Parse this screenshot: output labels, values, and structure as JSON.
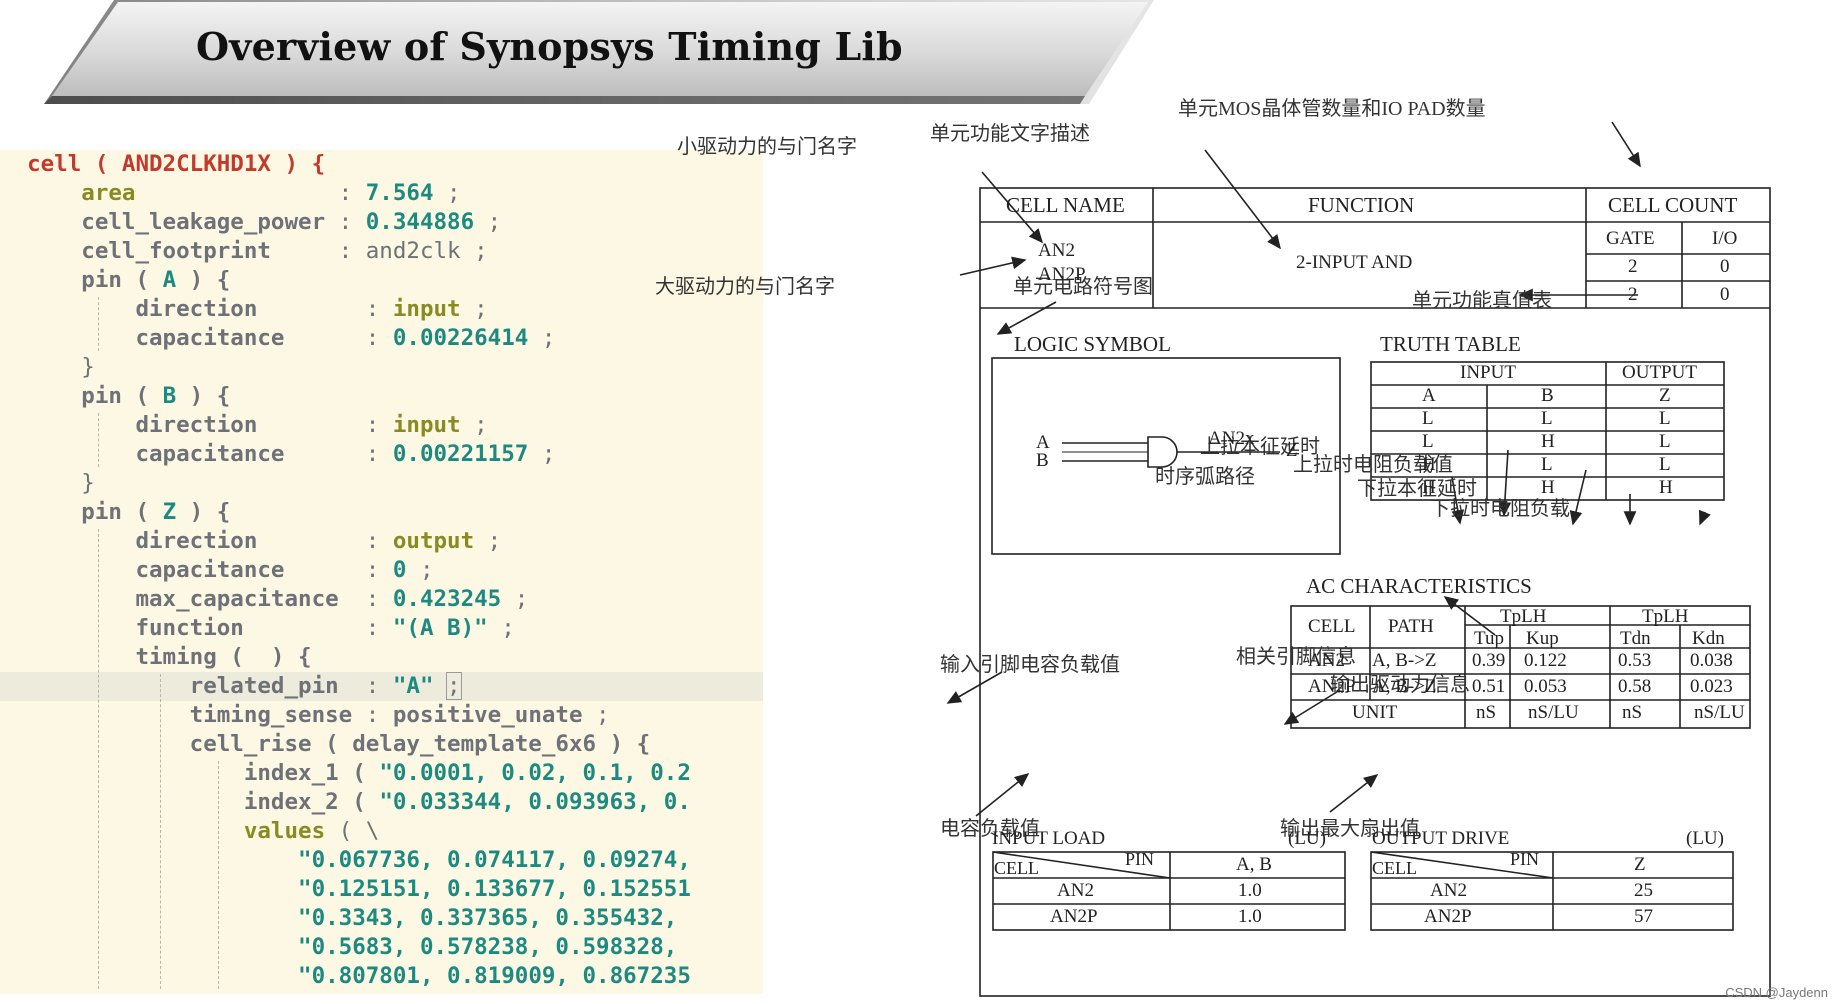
{
  "header": {
    "title": "Overview of Synopsys Timing Lib"
  },
  "code_lines": [
    {
      "tokens": [
        {
          "t": "cell ( AND2CLKHD1X ) {",
          "c": "k-red"
        }
      ]
    },
    {
      "tokens": [
        {
          "t": "    "
        },
        {
          "t": "area",
          "c": "k-ol"
        },
        {
          "t": "               : ",
          "c": "k-gy"
        },
        {
          "t": "7.564",
          "c": "k-val"
        },
        {
          "t": " ;",
          "c": "k-gy"
        }
      ]
    },
    {
      "tokens": [
        {
          "t": "    "
        },
        {
          "t": "cell_leakage_power",
          "c": "k-fn"
        },
        {
          "t": " : ",
          "c": "k-gy"
        },
        {
          "t": "0.344886",
          "c": "k-val"
        },
        {
          "t": " ;",
          "c": "k-gy"
        }
      ]
    },
    {
      "tokens": [
        {
          "t": "    "
        },
        {
          "t": "cell_footprint",
          "c": "k-fn"
        },
        {
          "t": "     : and2clk ;",
          "c": "k-gy"
        }
      ]
    },
    {
      "tokens": [
        {
          "t": "    "
        },
        {
          "t": "pin ( ",
          "c": "k-fn"
        },
        {
          "t": "A",
          "c": "k-val"
        },
        {
          "t": " ) {",
          "c": "k-fn"
        }
      ]
    },
    {
      "tokens": [
        {
          "t": "        "
        },
        {
          "t": "direction",
          "c": "k-fn"
        },
        {
          "t": "        : ",
          "c": "k-gy"
        },
        {
          "t": "input",
          "c": "k-ol"
        },
        {
          "t": " ;",
          "c": "k-gy"
        }
      ]
    },
    {
      "tokens": [
        {
          "t": "        "
        },
        {
          "t": "capacitance",
          "c": "k-fn"
        },
        {
          "t": "      : ",
          "c": "k-gy"
        },
        {
          "t": "0.00226414",
          "c": "k-val"
        },
        {
          "t": " ;",
          "c": "k-gy"
        }
      ]
    },
    {
      "tokens": [
        {
          "t": "    }",
          "c": "k-gy"
        }
      ]
    },
    {
      "tokens": [
        {
          "t": "    "
        },
        {
          "t": "pin ( ",
          "c": "k-fn"
        },
        {
          "t": "B",
          "c": "k-val"
        },
        {
          "t": " ) {",
          "c": "k-fn"
        }
      ]
    },
    {
      "tokens": [
        {
          "t": "        "
        },
        {
          "t": "direction",
          "c": "k-fn"
        },
        {
          "t": "        : ",
          "c": "k-gy"
        },
        {
          "t": "input",
          "c": "k-ol"
        },
        {
          "t": " ;",
          "c": "k-gy"
        }
      ]
    },
    {
      "tokens": [
        {
          "t": "        "
        },
        {
          "t": "capacitance",
          "c": "k-fn"
        },
        {
          "t": "      : ",
          "c": "k-gy"
        },
        {
          "t": "0.00221157",
          "c": "k-val"
        },
        {
          "t": " ;",
          "c": "k-gy"
        }
      ]
    },
    {
      "tokens": [
        {
          "t": "    }",
          "c": "k-gy"
        }
      ]
    },
    {
      "tokens": [
        {
          "t": "    "
        },
        {
          "t": "pin ( ",
          "c": "k-fn"
        },
        {
          "t": "Z",
          "c": "k-val"
        },
        {
          "t": " ) {",
          "c": "k-fn"
        }
      ]
    },
    {
      "tokens": [
        {
          "t": "        "
        },
        {
          "t": "direction",
          "c": "k-fn"
        },
        {
          "t": "        : ",
          "c": "k-gy"
        },
        {
          "t": "output",
          "c": "k-ol"
        },
        {
          "t": " ;",
          "c": "k-gy"
        }
      ]
    },
    {
      "tokens": [
        {
          "t": "        "
        },
        {
          "t": "capacitance",
          "c": "k-fn"
        },
        {
          "t": "      : ",
          "c": "k-gy"
        },
        {
          "t": "0",
          "c": "k-val"
        },
        {
          "t": " ;",
          "c": "k-gy"
        }
      ]
    },
    {
      "tokens": [
        {
          "t": "        "
        },
        {
          "t": "max_capacitance",
          "c": "k-fn"
        },
        {
          "t": "  : ",
          "c": "k-gy"
        },
        {
          "t": "0.423245",
          "c": "k-val"
        },
        {
          "t": " ;",
          "c": "k-gy"
        }
      ]
    },
    {
      "tokens": [
        {
          "t": "        "
        },
        {
          "t": "function",
          "c": "k-fn"
        },
        {
          "t": "         : ",
          "c": "k-gy"
        },
        {
          "t": "\"(A B)\"",
          "c": "k-val"
        },
        {
          "t": " ;",
          "c": "k-gy"
        }
      ]
    },
    {
      "tokens": [
        {
          "t": "        "
        },
        {
          "t": "timing (  ) {",
          "c": "k-fn"
        }
      ]
    },
    {
      "hl": true,
      "tokens": [
        {
          "t": "            "
        },
        {
          "t": "related_pin",
          "c": "k-fn"
        },
        {
          "t": "  : ",
          "c": "k-gy"
        },
        {
          "t": "\"A\"",
          "c": "k-val"
        },
        {
          "t": " "
        },
        {
          "t": ";",
          "c": "k-gy k-cur"
        }
      ]
    },
    {
      "tokens": [
        {
          "t": "            "
        },
        {
          "t": "timing_sense",
          "c": "k-fn"
        },
        {
          "t": " : ",
          "c": "k-gy"
        },
        {
          "t": "positive_unate",
          "c": "k-fn"
        },
        {
          "t": " ;",
          "c": "k-gy"
        }
      ]
    },
    {
      "tokens": [
        {
          "t": "            "
        },
        {
          "t": "cell_rise ( delay_template_6x6 ) {",
          "c": "k-fn"
        }
      ]
    },
    {
      "tokens": [
        {
          "t": "                "
        },
        {
          "t": "index_1 ( ",
          "c": "k-fn"
        },
        {
          "t": "\"0.0001, 0.02, 0.1, 0.2",
          "c": "k-val"
        }
      ]
    },
    {
      "tokens": [
        {
          "t": "                "
        },
        {
          "t": "index_2 ( ",
          "c": "k-fn"
        },
        {
          "t": "\"0.033344, 0.093963, 0.",
          "c": "k-val"
        }
      ]
    },
    {
      "tokens": [
        {
          "t": "                "
        },
        {
          "t": "values",
          "c": "k-ol"
        },
        {
          "t": " ( \\",
          "c": "k-gy"
        }
      ]
    },
    {
      "tokens": [
        {
          "t": "                    "
        },
        {
          "t": "\"0.067736, 0.074117, 0.09274,",
          "c": "k-val"
        }
      ]
    },
    {
      "tokens": [
        {
          "t": "                    "
        },
        {
          "t": "\"0.125151, 0.133677, 0.152551",
          "c": "k-val"
        }
      ]
    },
    {
      "tokens": [
        {
          "t": "                    "
        },
        {
          "t": "\"0.3343, 0.337365, 0.355432,",
          "c": "k-val"
        }
      ]
    },
    {
      "tokens": [
        {
          "t": "                    "
        },
        {
          "t": "\"0.5683, 0.578238, 0.598328,",
          "c": "k-val"
        }
      ]
    },
    {
      "tokens": [
        {
          "t": "                    "
        },
        {
          "t": "\"0.807801, 0.819009, 0.867235",
          "c": "k-val"
        }
      ]
    }
  ],
  "diagram": {
    "annotations": {
      "mos_count": "单元MOS晶体管数量和IO PAD数量",
      "func_desc": "单元功能文字描述",
      "small_drive_name": "小驱动力的与门名字",
      "large_drive_name": "大驱动力的与门名字",
      "symbol_note": "单元电路符号图",
      "truth_note": "单元功能真值表",
      "pullup_delay": "上拉本征延时",
      "timing_path": "时序弧路径",
      "pullup_res": "上拉时电阻负载值",
      "pulldown_delay": "下拉本征延时",
      "pulldown_res": "下拉时电阻负载",
      "related_pin": "相关引脚信息",
      "input_cap": "输入引脚电容负载值",
      "output_drive_info": "输出驱动力信息",
      "cap_load": "电容负载值",
      "max_fanout": "输出最大扇出值"
    },
    "top_table": {
      "cell_name_hdr": "CELL NAME",
      "function_hdr": "FUNCTION",
      "count_hdr": "CELL COUNT",
      "gate_hdr": "GATE",
      "io_hdr": "I/O",
      "names": [
        "AN2",
        "AN2P"
      ],
      "function": "2-INPUT AND",
      "gate_counts": [
        "2",
        "2"
      ],
      "io_counts": [
        "0",
        "0"
      ]
    },
    "logic_symbol": {
      "title": "LOGIC SYMBOL",
      "in_a": "A",
      "in_b": "B",
      "gate_label": "AN2x",
      "out": "Z"
    },
    "truth_table": {
      "title": "TRUTH TABLE",
      "input_hdr": "INPUT",
      "output_hdr": "OUTPUT",
      "cols": [
        "A",
        "B",
        "Z"
      ],
      "rows": [
        [
          "L",
          "L",
          "L"
        ],
        [
          "L",
          "H",
          "L"
        ],
        [
          "H",
          "L",
          "L"
        ],
        [
          "H",
          "H",
          "H"
        ]
      ]
    },
    "ac": {
      "title": "AC CHARACTERISTICS",
      "cell_hdr": "CELL",
      "path_hdr": "PATH",
      "group_hdrs": [
        "TpLH",
        "TpLH"
      ],
      "sub_hdrs": [
        "Tup",
        "Kup",
        "Tdn",
        "Kdn"
      ],
      "rows": [
        {
          "cell": "AN2",
          "path": "A, B->Z",
          "vals": [
            "0.39",
            "0.122",
            "0.53",
            "0.038"
          ]
        },
        {
          "cell": "AN2P",
          "path": "A, B->Z",
          "vals": [
            "0.51",
            "0.053",
            "0.58",
            "0.023"
          ]
        }
      ],
      "unit_label": "UNIT",
      "units": [
        "nS",
        "nS/LU",
        "nS",
        "nS/LU"
      ]
    },
    "input_load": {
      "title": "INPUT LOAD",
      "unit": "(LU)",
      "cell_hdr": "CELL",
      "pin_hdr": "PIN",
      "col_hdr": "A, B",
      "rows": [
        {
          "cell": "AN2",
          "val": "1.0"
        },
        {
          "cell": "AN2P",
          "val": "1.0"
        }
      ]
    },
    "output_drive": {
      "title": "OUTPUT DRIVE",
      "unit": "(LU)",
      "cell_hdr": "CELL",
      "pin_hdr": "PIN",
      "col_hdr": "Z",
      "rows": [
        {
          "cell": "AN2",
          "val": "25"
        },
        {
          "cell": "AN2P",
          "val": "57"
        }
      ]
    }
  },
  "watermark": "CSDN @Jaydenn"
}
